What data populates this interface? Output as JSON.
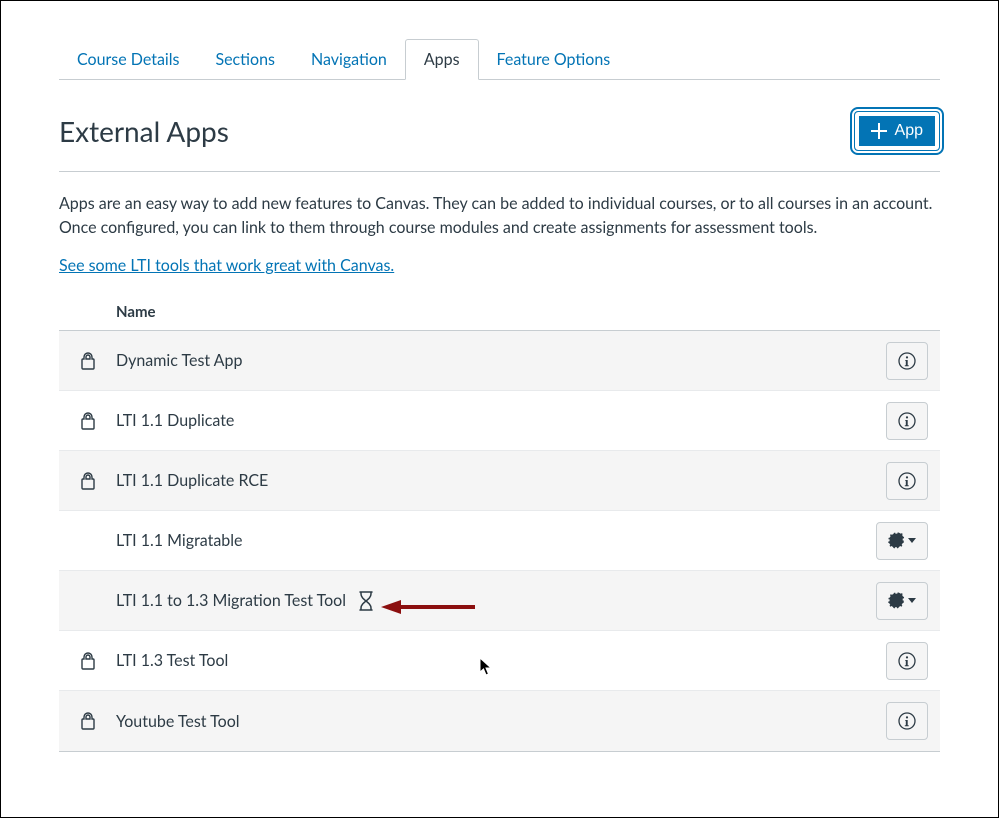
{
  "tabs": [
    {
      "label": "Course Details",
      "active": false
    },
    {
      "label": "Sections",
      "active": false
    },
    {
      "label": "Navigation",
      "active": false
    },
    {
      "label": "Apps",
      "active": true
    },
    {
      "label": "Feature Options",
      "active": false
    }
  ],
  "page_title": "External Apps",
  "add_button": {
    "label": "App"
  },
  "description": "Apps are an easy way to add new features to Canvas. They can be added to individual courses, or to all courses in an account. Once configured, you can link to them through course modules and create assignments for assessment tools.",
  "lti_link": "See some LTI tools that work great with Canvas.",
  "table": {
    "header": {
      "name": "Name"
    },
    "rows": [
      {
        "name": "Dynamic Test App",
        "locked": true,
        "action": "info",
        "alt": true,
        "highlight": false
      },
      {
        "name": "LTI 1.1 Duplicate",
        "locked": true,
        "action": "info",
        "alt": false,
        "highlight": false
      },
      {
        "name": "LTI 1.1 Duplicate RCE",
        "locked": true,
        "action": "info",
        "alt": true,
        "highlight": false
      },
      {
        "name": "LTI 1.1 Migratable",
        "locked": false,
        "action": "gear",
        "alt": false,
        "highlight": false
      },
      {
        "name": "LTI 1.1 to 1.3 Migration Test Tool",
        "locked": false,
        "action": "gear",
        "alt": true,
        "highlight": true
      },
      {
        "name": "LTI 1.3 Test Tool",
        "locked": true,
        "action": "info",
        "alt": false,
        "highlight": false
      },
      {
        "name": "Youtube Test Tool",
        "locked": true,
        "action": "info",
        "alt": true,
        "highlight": false
      }
    ]
  }
}
